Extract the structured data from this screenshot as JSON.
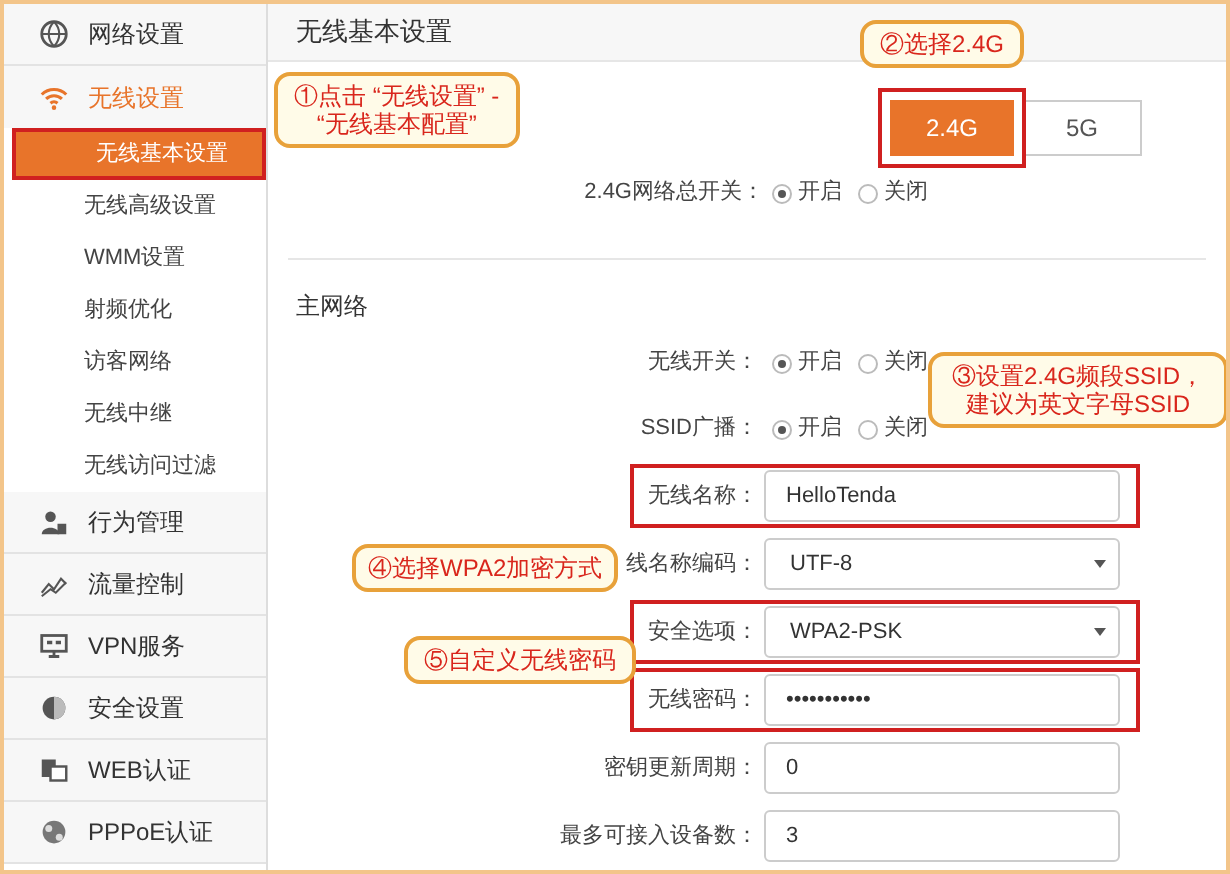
{
  "sidebar": {
    "items": [
      {
        "kind": "group",
        "label": "网络设置",
        "selected": false,
        "expanded": false
      },
      {
        "kind": "group",
        "label": "无线设置",
        "selected": true,
        "expanded": true
      },
      {
        "kind": "sub",
        "label": "无线基本设置",
        "selected": true
      },
      {
        "kind": "sub",
        "label": "无线高级设置",
        "selected": false
      },
      {
        "kind": "sub",
        "label": "WMM设置",
        "selected": false
      },
      {
        "kind": "sub",
        "label": "射频优化",
        "selected": false
      },
      {
        "kind": "sub",
        "label": "访客网络",
        "selected": false
      },
      {
        "kind": "sub",
        "label": "无线中继",
        "selected": false
      },
      {
        "kind": "sub",
        "label": "无线访问过滤",
        "selected": false
      },
      {
        "kind": "group",
        "label": "行为管理",
        "selected": false,
        "expanded": false
      },
      {
        "kind": "group",
        "label": "流量控制",
        "selected": false,
        "expanded": false
      },
      {
        "kind": "group",
        "label": "VPN服务",
        "selected": false,
        "expanded": false
      },
      {
        "kind": "group",
        "label": "安全设置",
        "selected": false,
        "expanded": false
      },
      {
        "kind": "group",
        "label": "WEB认证",
        "selected": false,
        "expanded": false
      },
      {
        "kind": "group",
        "label": "PPPoE认证",
        "selected": false,
        "expanded": false
      }
    ]
  },
  "page_title": "无线基本设置",
  "band_tabs": [
    {
      "label": "2.4G",
      "selected": true
    },
    {
      "label": "5G",
      "selected": false
    }
  ],
  "master_switch": {
    "label": "2.4G网络总开关：",
    "options": [
      {
        "label": "开启",
        "selected": true
      },
      {
        "label": "关闭",
        "selected": false
      }
    ]
  },
  "section_title": "主网络",
  "rows": [
    {
      "kind": "radio",
      "label": "无线开关：",
      "options": [
        {
          "label": "开启",
          "selected": true
        },
        {
          "label": "关闭",
          "selected": false
        }
      ]
    },
    {
      "kind": "radio",
      "label": "SSID广播：",
      "options": [
        {
          "label": "开启",
          "selected": true
        },
        {
          "label": "关闭",
          "selected": false
        }
      ]
    },
    {
      "kind": "text",
      "label": "无线名称：",
      "value": "HelloTenda",
      "highlighted": true
    },
    {
      "kind": "select",
      "label": "线名称编码：",
      "value": "UTF-8",
      "highlighted": false
    },
    {
      "kind": "select",
      "label": "安全选项：",
      "value": "WPA2-PSK",
      "highlighted": true
    },
    {
      "kind": "password",
      "label": "无线密码：",
      "value": "•••••••••••",
      "highlighted": true
    },
    {
      "kind": "text",
      "label": "密钥更新周期：",
      "value": "0",
      "highlighted": false
    },
    {
      "kind": "text",
      "label": "最多可接入设备数：",
      "value": "3",
      "highlighted": false
    }
  ],
  "annotations": [
    "①点击 “无线设置” -\n“无线基本配置”",
    "②选择2.4G",
    "③设置2.4G频段SSID，建议为英文字母SSID",
    "④选择WPA2加密方式",
    "⑤自定义无线密码"
  ]
}
